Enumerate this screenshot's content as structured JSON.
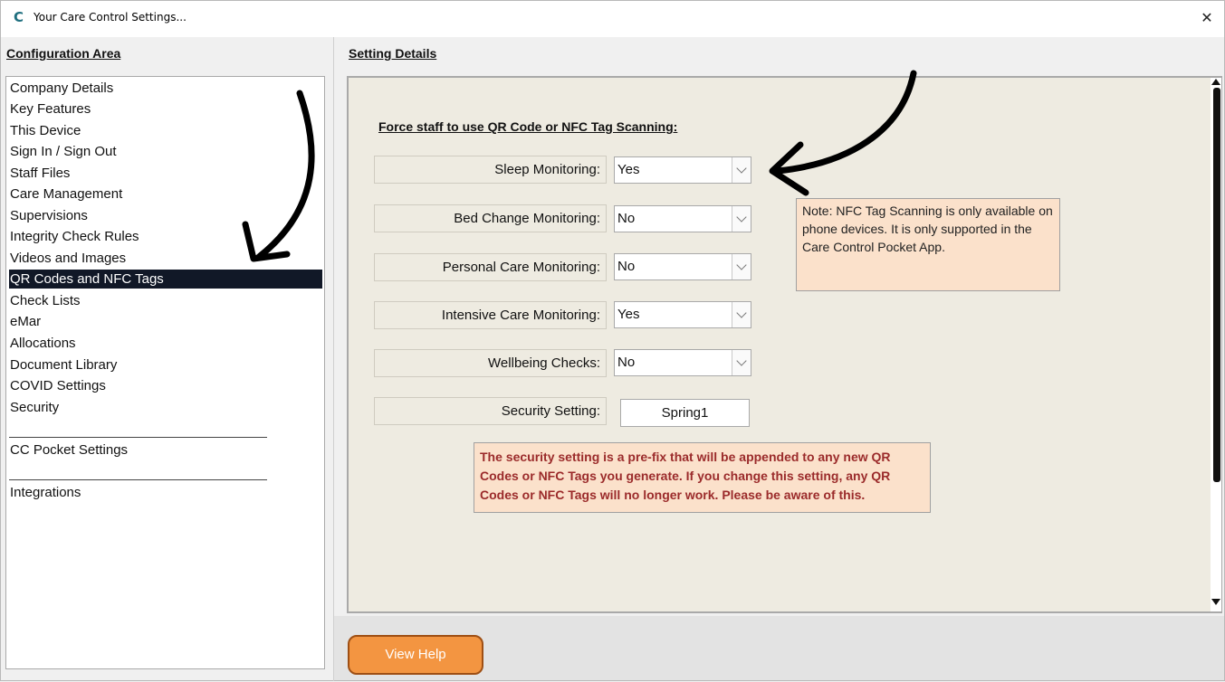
{
  "window": {
    "title": "Your Care Control Settings...",
    "logo_letter": "C",
    "close_glyph": "✕"
  },
  "left": {
    "heading": "Configuration Area",
    "items": [
      "Company Details",
      "Key Features",
      "This Device",
      "Sign In / Sign Out",
      "Staff Files",
      "Care Management",
      "Supervisions",
      "Integrity Check Rules",
      "Videos and Images",
      "QR Codes and NFC Tags",
      "Check Lists",
      "eMar",
      "Allocations",
      "Document Library",
      "COVID Settings",
      "Security",
      "CC Pocket Settings",
      "Integrations"
    ],
    "selected": "QR Codes and NFC Tags"
  },
  "details": {
    "heading": "Setting Details",
    "section_title": "Force staff to use QR Code or NFC Tag Scanning:",
    "settings": [
      {
        "label": "Sleep Monitoring:",
        "value": "Yes"
      },
      {
        "label": "Bed Change Monitoring:",
        "value": "No"
      },
      {
        "label": "Personal Care Monitoring:",
        "value": "No"
      },
      {
        "label": "Intensive Care Monitoring:",
        "value": "Yes"
      },
      {
        "label": "Wellbeing Checks:",
        "value": "No"
      }
    ],
    "security": {
      "label": "Security Setting:",
      "value": "Spring1"
    },
    "note": "Note: NFC Tag Scanning is only available on phone devices.  It is only supported in the Care Control Pocket App.",
    "warning": "The security setting is a pre-fix that will be appended to any new QR Codes or NFC Tags you generate.  If you change this setting, any QR Codes or NFC Tags will no longer work.  Please be aware of this."
  },
  "footer": {
    "help_label": "View Help"
  },
  "colors": {
    "selected_bg": "#111827",
    "note_bg": "#fbe1cb",
    "warning_text": "#9b2b2b",
    "button": "#f39541",
    "panel_bg": "#eeebe1"
  }
}
